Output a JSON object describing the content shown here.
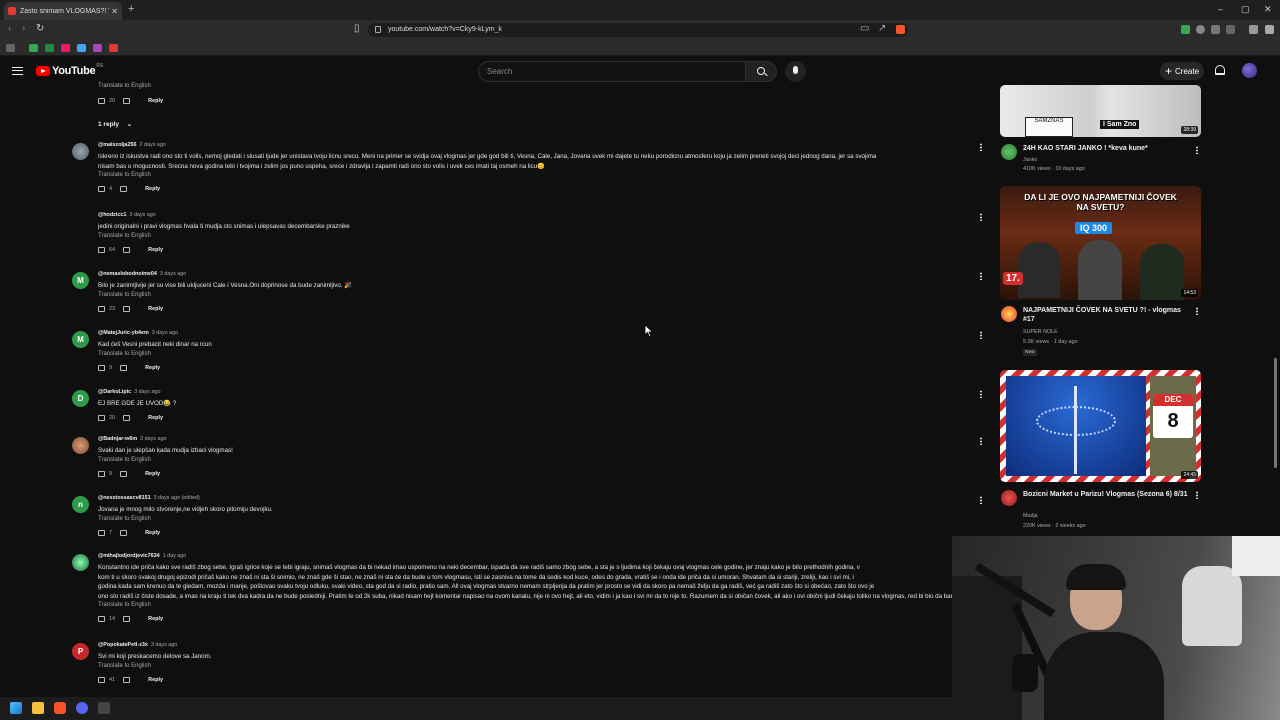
{
  "browser": {
    "tab_title": "Zasto snimam VLOGMAS?! Vlog",
    "url": "youtube.com/watch?v=Cky9-kLym_k",
    "new_tab": "+",
    "window_controls": [
      "–",
      "▢",
      "✕"
    ]
  },
  "header": {
    "logo_text": "YouTube",
    "country": "RS",
    "search_placeholder": "Search",
    "create_label": "Create"
  },
  "comments": {
    "prev": {
      "translate": "Translate to English",
      "likes": "20",
      "reply": "Reply"
    },
    "replies_toggle": "1 reply",
    "items": [
      {
        "handle": "@malszolja256",
        "ago": "2 days ago",
        "text_lines": [
          "Iskreno iz iskustva radi ono sto ti volis, nemoj gledati i slusati ljude jer unistava tvoju licnu srecu. Meni na primer se svidja ovaj vlogmas jer gde god bili ti, Vesna, Cale, Jana, Jovana uvek mi dajete tu neku porodicnu atmosferu koju ja zelim preneti svojoj deci jednog dana, jer sa svojima",
          "nisam bas u mogucnosti. Srecna nova godina tebi i tvojima i zelim jos puno uspeha, srece i zdravlja i zapamti radi ono sto volis  i uvek ces imati taj osmeh na licu😊"
        ],
        "translate": "Translate to English",
        "likes": "4",
        "reply": "Reply"
      },
      {
        "handle": "@hodzicc1",
        "ago": "3 days ago",
        "text_lines": [
          "jedini originalni i pravi vlogmas hvala ti mudja sto snimas i ulepsavas decembarske praznike"
        ],
        "translate": "Translate to English",
        "likes": "64",
        "reply": "Reply"
      },
      {
        "handle": "@nemaslobodnoime04",
        "ago": "3 days ago",
        "text_lines": [
          "Bilo je zanimljivije jer su vise bili ukljuceni Cale i Vesna.Oni doprinose da bude zanimljivo. 🎉"
        ],
        "translate": "Translate to English",
        "likes": "23",
        "reply": "Reply"
      },
      {
        "handle": "@MatejJuric-yb4em",
        "ago": "3 days ago",
        "text_lines": [
          "Kad ćeš Vesni prebacit neki dinar na rcun"
        ],
        "translate": "Translate to English",
        "likes": "9",
        "reply": "Reply"
      },
      {
        "handle": "@DarkoLipic",
        "ago": "3 days ago",
        "text_lines": [
          "EJ BRE GDE JE UVOD😂 ?"
        ],
        "translate": "",
        "likes": "20",
        "reply": "Reply"
      },
      {
        "handle": "@Badnjar-w6m",
        "ago": "3 days ago",
        "text_lines": [
          "Svaki dan je ulepšan kada mudja izbaci vlogmas!"
        ],
        "translate": "Translate to English",
        "likes": "9",
        "reply": "Reply"
      },
      {
        "handle": "@nesstossascv8151",
        "ago": "3 days ago (edited)",
        "text_lines": [
          "Jovana je mnog milo stvorenje,ne vidjeh skoro pitomiju devojku."
        ],
        "translate": "Translate to English",
        "likes": "7",
        "reply": "Reply"
      },
      {
        "handle": "@mihajlodjordjevic7634",
        "ago": "1 day ago",
        "text_lines": [
          "Konstantno ide priča kako sve radiš zbog sebe, Igraš igrice koje se tebi igraju, snimaš vlogmas da bi nekad imao uspomenu na neki decembar, ispada da sve radiš samo zbog sebe, a sta je s ljudima koji čekaju ovaj vlogmas cele godine, jer znaju kako je bilo prethodnih godina, v",
          "kom ti u skoro svakoj drugoj epizodi pričaš kako ne znaš ni sta ši snimio, ne znaš gde ši stao, ne znaš ni sta će da bude u tom vlogmasu, isti se zasniva na tome da sedis kod kuce, odes do grada, vratiš se i onda ide priča da si umoran. Shvatam da si stariji, zreliji, kao i svi mi, i",
          "godina kada sam krenuo da te gledam, mozda i manje, poštovao svaku tvoju odluku, svaki video, sta god da si radio, pratio sam. All ovaj vlogmas stvarno nemam strpljenja da pratim jer prosto se vidi da skoro pa nemaš želju da ga radiš, već ga radiš zato što si obećao, zato što ovo je",
          "ono sto radiš iz čiste dosade, a imas na kraju ti tek dva kadra da ne bude posledniji. Pratim te od 2k suba, nikad nisam hejt komentar napisao na ovom kanalu, nije ni ovo hejt, ali eto, vidim i ja kao i svi mi da to nije to. Razumem da si običan čovek, ali ako i ovi obični ljudi čekaju toliko na vlogmas, red bi bio da bar malo više truda ul"
        ],
        "translate": "Translate to English",
        "likes": "14",
        "reply": "Reply"
      },
      {
        "handle": "@PopokatePetl-z3x",
        "ago": "3 days ago",
        "text_lines": [
          "Svi mi koji preskacemo delove sa Janom."
        ],
        "translate": "Translate to English",
        "likes": "41",
        "reply": "Reply"
      }
    ]
  },
  "sidebar": {
    "videos": [
      {
        "title": "24H KAO STARI JANKO ! *keva kune*",
        "channel": "Janko",
        "meta": "410K views · 10 days ago",
        "duration": "28:39",
        "thumb_text": "I Sam Zno",
        "badge": ""
      },
      {
        "title": "NAJPAMETNIJI ČOVEK NA SVETU ?! - vlogmas #17",
        "channel": "SUPER NOLE",
        "meta": "5.3K views · 1 day ago",
        "duration": "14:53",
        "thumb_text": "DA LI JE OVO NAJPAMETNIJI ČOVEK NA SVETU?",
        "thumb_badge": "IQ 300",
        "thumb_num": "17.",
        "badge": "New"
      },
      {
        "title": "Bozicni Market u Parizu! Vlogmas (Sezona 6) 8/31",
        "channel": "Mudja",
        "meta": "220K views · 2 weeks ago",
        "duration": "24:45",
        "thumb_month": "DEC",
        "thumb_day": "8",
        "badge": ""
      }
    ]
  },
  "colors": {
    "background": "#0f0f0f",
    "accent": "#ff0000",
    "text": "#f1f1f1",
    "muted": "#aaaaaa"
  }
}
